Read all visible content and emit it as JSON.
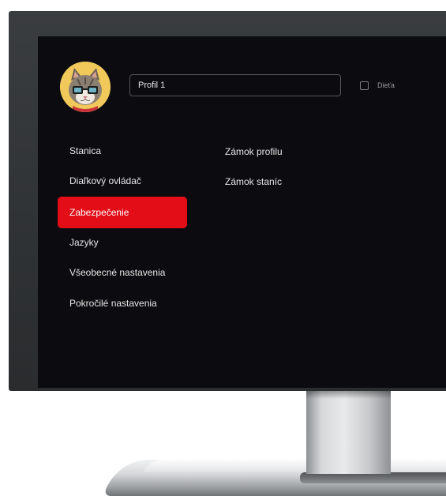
{
  "profile": {
    "name_value": "Profil 1",
    "child_label": "Dieťa",
    "child_checked": false,
    "avatar_icon": "cat-with-glasses-avatar"
  },
  "menu": {
    "items": [
      {
        "label": "Stanica",
        "active": false
      },
      {
        "label": "Diaľkový ovládač",
        "active": false
      },
      {
        "label": "Zabezpečenie",
        "active": true
      },
      {
        "label": "Jazyky",
        "active": false
      },
      {
        "label": "Všeobecné nastavenia",
        "active": false
      },
      {
        "label": "Pokročilé nastavenia",
        "active": false
      }
    ]
  },
  "submenu": {
    "items": [
      {
        "label": "Zámok profilu"
      },
      {
        "label": "Zámok staníc"
      }
    ]
  },
  "colors": {
    "accent": "#e20d17",
    "screen_background": "#0c0c10",
    "avatar_background": "#f0c95a"
  }
}
